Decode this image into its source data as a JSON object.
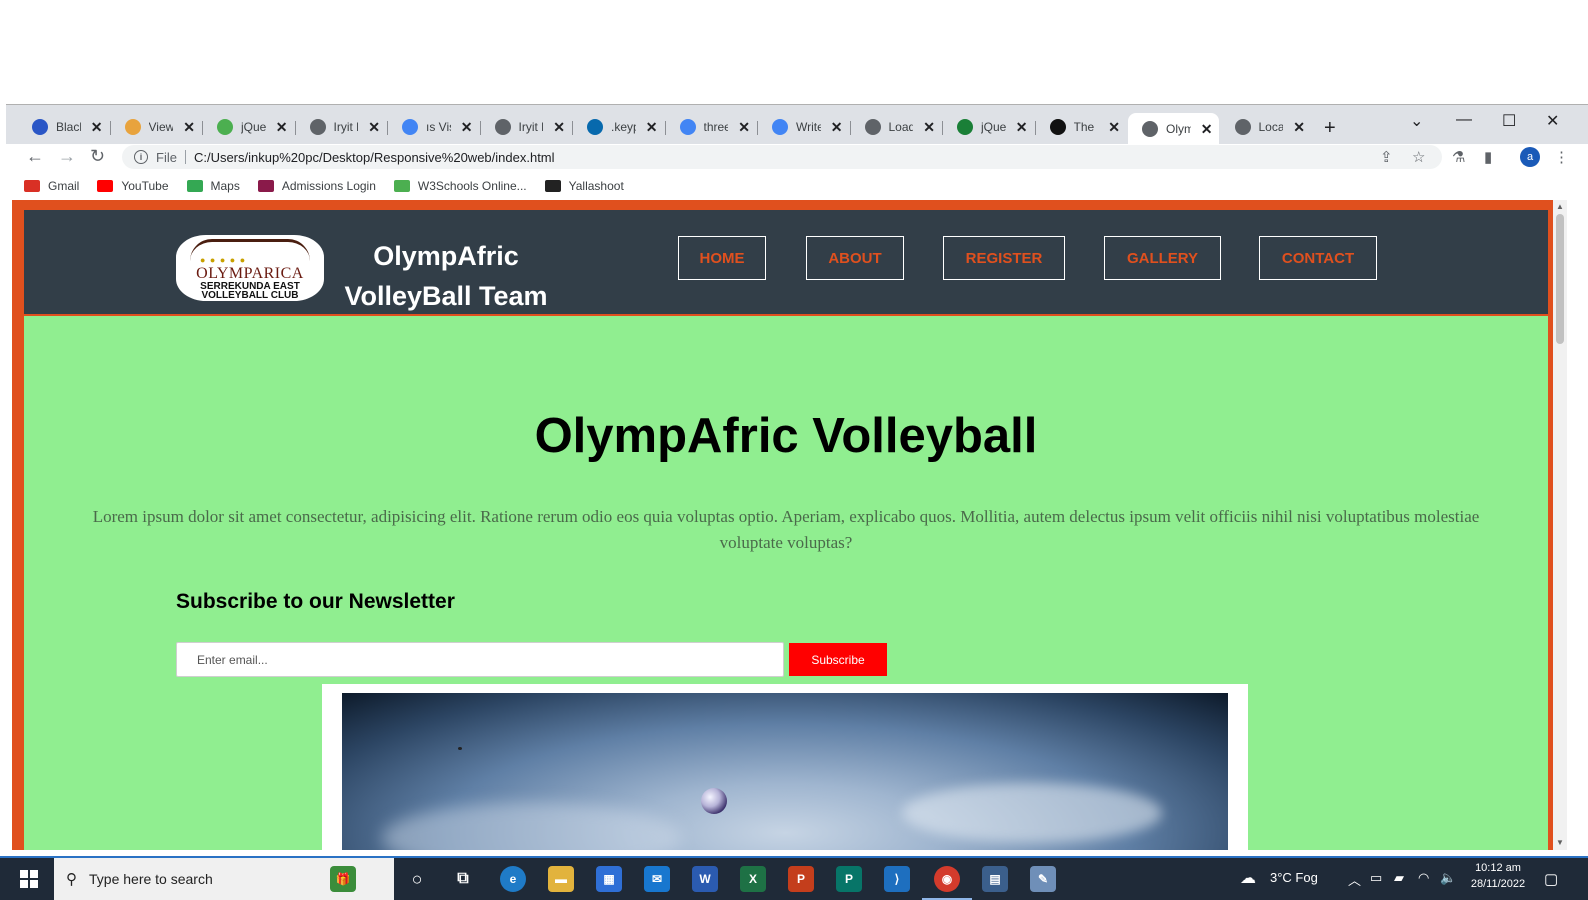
{
  "browser": {
    "tabs": [
      {
        "label": "Blackl",
        "icon": "blackboard-icon",
        "color": "#2a56c6"
      },
      {
        "label": "View",
        "icon": "view-icon",
        "color": "#e8a33d"
      },
      {
        "label": "jQuer",
        "icon": "w3schools-icon",
        "color": "#4caf50"
      },
      {
        "label": "Iryit F",
        "icon": "globe-icon",
        "color": "#5f6368"
      },
      {
        "label": "ıs Visi",
        "icon": "google-icon",
        "color": "#4285f4"
      },
      {
        "label": "Iryit F",
        "icon": "globe-icon",
        "color": "#5f6368"
      },
      {
        "label": ".keyp",
        "icon": "jquery-icon",
        "color": "#0769ad"
      },
      {
        "label": "three",
        "icon": "google-icon",
        "color": "#4285f4"
      },
      {
        "label": "Write",
        "icon": "google-icon",
        "color": "#4285f4"
      },
      {
        "label": "Loadi",
        "icon": "loader-icon",
        "color": "#5f6368"
      },
      {
        "label": "jQuer",
        "icon": "wikipedia-icon",
        "color": "#1a7f37"
      },
      {
        "label": "The H",
        "icon": "devsite-icon",
        "color": "#111111"
      },
      {
        "label": "Olym",
        "icon": "globe-icon",
        "color": "#5f6368"
      },
      {
        "label": "Local",
        "icon": "globe-icon",
        "color": "#5f6368"
      }
    ],
    "url_scheme_label": "File",
    "url": "C:/Users/inkup%20pc/Desktop/Responsive%20web/index.html",
    "profile_initial": "a",
    "bookmarks": [
      {
        "label": "Gmail",
        "icon": "gmail-icon",
        "color": "#d93025"
      },
      {
        "label": "YouTube",
        "icon": "youtube-icon",
        "color": "#ff0000"
      },
      {
        "label": "Maps",
        "icon": "maps-icon",
        "color": "#34a853"
      },
      {
        "label": "Admissions Login",
        "icon": "admissions-icon",
        "color": "#8a1a4a"
      },
      {
        "label": "W3Schools Online...",
        "icon": "w3schools-icon",
        "color": "#4caf50"
      },
      {
        "label": "Yallashoot",
        "icon": "yallashoot-icon",
        "color": "#222222"
      }
    ]
  },
  "site": {
    "logo": {
      "line1": "OLYMPARICA",
      "line2": "SERREKUNDA EAST",
      "line3": "VOLLEYBALL CLUB"
    },
    "title_line1": "OlympAfric",
    "title_line2": "VolleyBall Team",
    "nav": [
      "HOME",
      "ABOUT",
      "REGISTER",
      "GALLERY",
      "CONTACT"
    ],
    "hero_title": "OlympAfric Volleyball",
    "hero_text": "Lorem ipsum dolor sit amet consectetur, adipisicing elit. Ratione rerum odio eos quia voluptas optio. Aperiam, explicabo quos. Mollitia, autem delectus ipsum velit officiis nihil nisi voluptatibus molestiae voluptate voluptas?",
    "newsletter_title": "Subscribe to our Newsletter",
    "email_placeholder": "Enter email...",
    "subscribe_label": "Subscribe",
    "colors": {
      "accent": "#e0501e",
      "header_bg": "#323e48",
      "page_bg": "#90ee90",
      "button": "#ff0000"
    }
  },
  "taskbar": {
    "search_placeholder": "Type here to search",
    "weather": "3°C  Fog",
    "time": "10:12 am",
    "date": "28/11/2022"
  }
}
